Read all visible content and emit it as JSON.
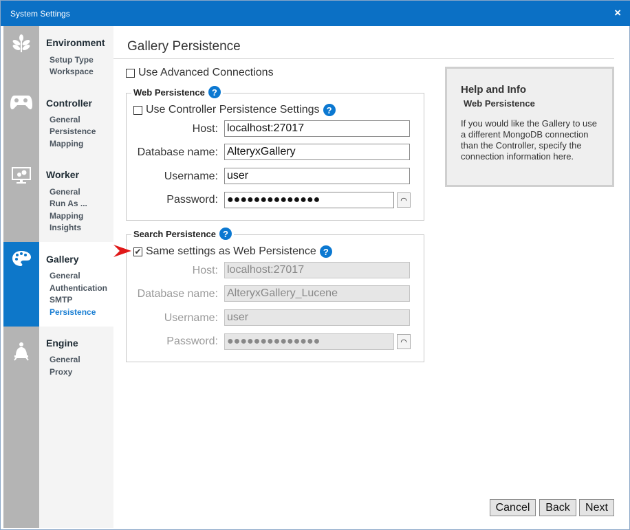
{
  "window": {
    "title": "System Settings",
    "close": "×"
  },
  "nav": [
    {
      "title": "Environment",
      "icon": "plant-icon",
      "items": [
        "Setup Type",
        "Workspace"
      ]
    },
    {
      "title": "Controller",
      "icon": "gamepad-icon",
      "items": [
        "General",
        "Persistence",
        "Mapping"
      ]
    },
    {
      "title": "Worker",
      "icon": "monitor-gears-icon",
      "items": [
        "General",
        "Run As ...",
        "Mapping",
        "Insights"
      ]
    },
    {
      "title": "Gallery",
      "icon": "palette-icon",
      "items": [
        "General",
        "Authentication",
        "SMTP",
        "Persistence"
      ]
    },
    {
      "title": "Engine",
      "icon": "locomotive-icon",
      "items": [
        "General",
        "Proxy"
      ]
    }
  ],
  "page": {
    "title": "Gallery Persistence",
    "advanced": "Use Advanced Connections"
  },
  "web": {
    "legend": "Web Persistence",
    "use_controller": "Use Controller Persistence Settings",
    "host_label": "Host:",
    "host": "localhost:27017",
    "db_label": "Database name:",
    "db": "AlteryxGallery",
    "user_label": "Username:",
    "user": "user",
    "pass_label": "Password:",
    "pass": "●●●●●●●●●●●●●●"
  },
  "search": {
    "legend": "Search Persistence",
    "same": "Same settings as Web Persistence",
    "host_label": "Host:",
    "host": "localhost:27017",
    "db_label": "Database name:",
    "db": "AlteryxGallery_Lucene",
    "user_label": "Username:",
    "user": "user",
    "pass_label": "Password:",
    "pass": "●●●●●●●●●●●●●●"
  },
  "help": {
    "title": "Help and Info",
    "subtitle": "Web Persistence",
    "text": "If you would like the Gallery to use a different MongoDB connection than the Controller, specify the connection information here."
  },
  "buttons": {
    "cancel": "Cancel",
    "back": "Back",
    "next": "Next"
  },
  "help_glyph": "?",
  "eye_glyph": "◠"
}
